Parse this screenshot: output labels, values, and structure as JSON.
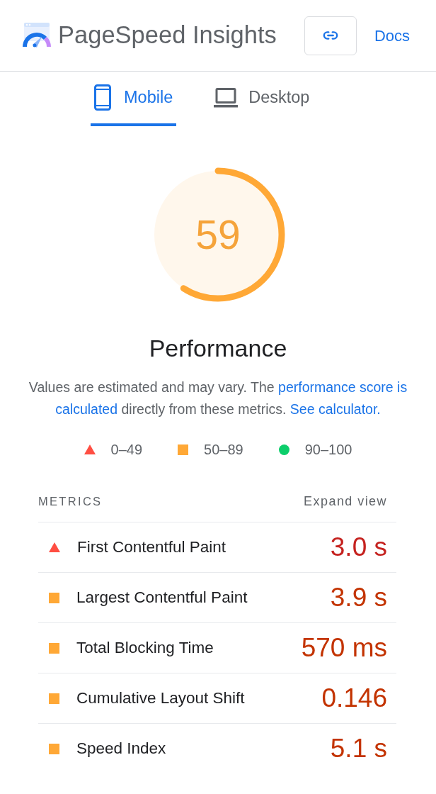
{
  "header": {
    "title": "PageSpeed Insights",
    "docs_link": "Docs"
  },
  "tabs": [
    {
      "label": "Mobile",
      "selected": true
    },
    {
      "label": "Desktop",
      "selected": false
    }
  ],
  "gauge": {
    "score": "59",
    "level": 0.59,
    "kind": "average",
    "label": "Performance"
  },
  "description": [
    {
      "kind": "text",
      "text": "Values are estimated and may vary. The "
    },
    {
      "kind": "link",
      "text": "performance score is"
    },
    {
      "kind": "link",
      "text": "calculated"
    },
    {
      "kind": "text",
      "text": " directly from these metrics. "
    },
    {
      "kind": "link",
      "text": "See calculator."
    }
  ],
  "legend": [
    {
      "kind": "fail",
      "label": "0–49"
    },
    {
      "kind": "average",
      "label": "50–89"
    },
    {
      "kind": "pass",
      "label": "90–100"
    }
  ],
  "metrics": {
    "title": "METRICS",
    "expand_link": "Expand view",
    "rows": [
      {
        "kind": "fail",
        "name": "First Contentful Paint",
        "value": "3.0 s"
      },
      {
        "kind": "average",
        "name": "Largest Contentful Paint",
        "value": "3.9 s"
      },
      {
        "kind": "average",
        "name": "Total Blocking Time",
        "value": "570 ms"
      },
      {
        "kind": "average",
        "name": "Cumulative Layout Shift",
        "value": "0.146"
      },
      {
        "kind": "average",
        "name": "Speed Index",
        "value": "5.1 s"
      }
    ]
  }
}
